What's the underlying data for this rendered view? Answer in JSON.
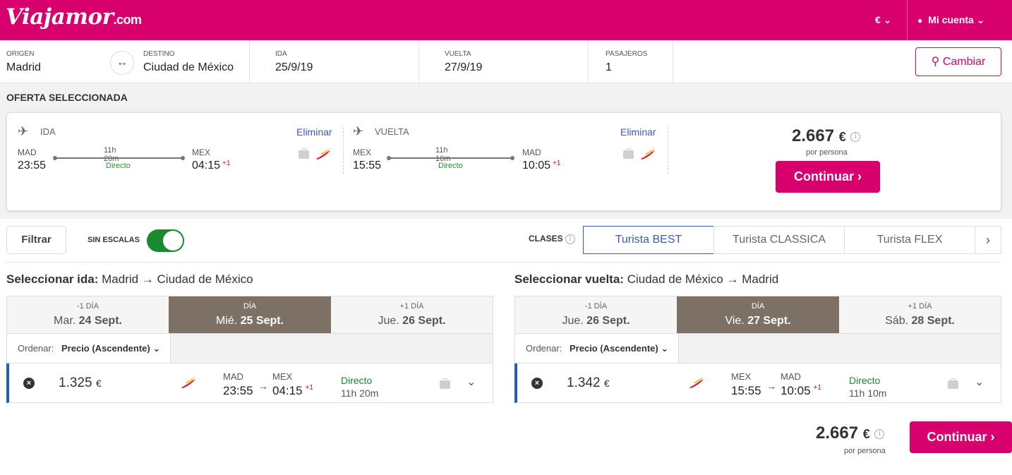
{
  "header": {
    "logo": "Viajamor",
    "logo_suffix": ".com",
    "currency": "€ ⌄",
    "account": "Mi cuenta ⌄"
  },
  "search": {
    "origen_label": "ORIGEN",
    "origen": "Madrid",
    "destino_label": "DESTINO",
    "destino": "Ciudad de México",
    "ida_label": "IDA",
    "ida": "25/9/19",
    "vuelta_label": "VUELTA",
    "vuelta": "27/9/19",
    "pasajeros_label": "PASAJEROS",
    "pasajeros": "1",
    "cambiar": "Cambiar"
  },
  "offer": {
    "title": "OFERTA SELECCIONADA",
    "ida": {
      "label": "IDA",
      "eliminar": "Eliminar",
      "from": "MAD",
      "to": "MEX",
      "dep": "23:55",
      "arr": "04:15",
      "plus": "+1",
      "duration": "11h 20m",
      "type": "Directo"
    },
    "vuelta": {
      "label": "VUELTA",
      "eliminar": "Eliminar",
      "from": "MEX",
      "to": "MAD",
      "dep": "15:55",
      "arr": "10:05",
      "plus": "+1",
      "duration": "11h 10m",
      "type": "Directo"
    },
    "price": "2.667",
    "currency": "€",
    "per_person": "por persona",
    "continuar": "Continuar"
  },
  "filters": {
    "filtrar": "Filtrar",
    "sin_escalas": "SIN ESCALAS",
    "clases": "CLASES",
    "classes": [
      "Turista BEST",
      "Turista CLASSICA",
      "Turista FLEX"
    ]
  },
  "ida_col": {
    "head_bold": "Seleccionar ida:",
    "head_rest": "Madrid → Ciudad de México",
    "days": [
      {
        "small": "-1 DÍA",
        "dow": "Mar.",
        "date": "24 Sept."
      },
      {
        "small": "DÍA",
        "dow": "Mié.",
        "date": "25 Sept."
      },
      {
        "small": "+1 DÍA",
        "dow": "Jue.",
        "date": "26 Sept."
      }
    ],
    "sort_label": "Ordenar:",
    "sort_value": "Precio (Ascendente) ⌄",
    "result": {
      "price": "1.325",
      "currency": "€",
      "from": "MAD",
      "to": "MEX",
      "dep": "23:55",
      "arr": "04:15",
      "plus": "+1",
      "type": "Directo",
      "duration": "11h 20m"
    }
  },
  "vuelta_col": {
    "head_bold": "Seleccionar vuelta:",
    "head_rest": "Ciudad de México → Madrid",
    "days": [
      {
        "small": "-1 DÍA",
        "dow": "Jue.",
        "date": "26 Sept."
      },
      {
        "small": "DÍA",
        "dow": "Vie.",
        "date": "27 Sept."
      },
      {
        "small": "+1 DÍA",
        "dow": "Sáb.",
        "date": "28 Sept."
      }
    ],
    "sort_label": "Ordenar:",
    "sort_value": "Precio (Ascendente) ⌄",
    "result": {
      "price": "1.342",
      "currency": "€",
      "from": "MEX",
      "to": "MAD",
      "dep": "15:55",
      "arr": "10:05",
      "plus": "+1",
      "type": "Directo",
      "duration": "11h 10m"
    }
  },
  "bottom": {
    "price": "2.667",
    "currency": "€",
    "per_person": "por persona",
    "continuar": "Continuar"
  },
  "colors": {
    "brand": "#d8006c",
    "accent_blue": "#1d5fc2",
    "direct_green": "#1a8a2e",
    "active_day": "#7d7165"
  }
}
